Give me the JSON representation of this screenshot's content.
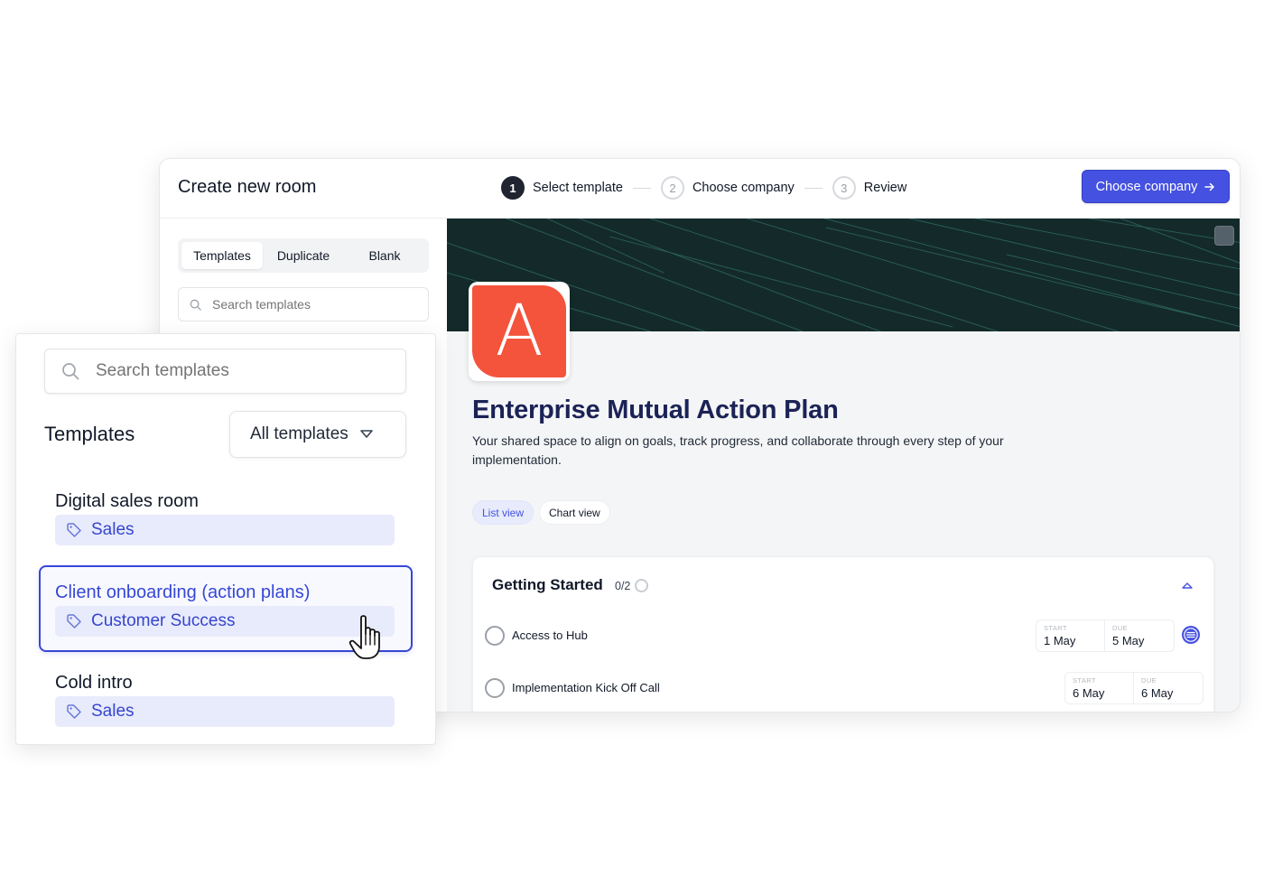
{
  "window": {
    "title": "Create new room",
    "steps": [
      {
        "num": "1",
        "label": "Select template"
      },
      {
        "num": "2",
        "label": "Choose company"
      },
      {
        "num": "3",
        "label": "Review"
      }
    ],
    "primary_button": "Choose company"
  },
  "left_pane": {
    "tabs": [
      "Templates",
      "Duplicate",
      "Blank"
    ],
    "search_placeholder": "Search templates"
  },
  "preview": {
    "logo_letter": "A",
    "title": "Enterprise Mutual Action Plan",
    "description": "Your shared space to align on goals, track progress, and collaborate through every step of your implementation.",
    "views": [
      "List view",
      "Chart view"
    ],
    "section": {
      "title": "Getting Started",
      "count": "0/2",
      "tasks": [
        {
          "name": "Access to Hub",
          "start_label": "START",
          "start": "1 May",
          "due_label": "DUE",
          "due": "5 May"
        },
        {
          "name": "Implementation Kick Off Call",
          "start_label": "START",
          "start": "6 May",
          "due_label": "DUE",
          "due": "6 May"
        }
      ]
    }
  },
  "panel": {
    "search_placeholder": "Search templates",
    "heading": "Templates",
    "filter_label": "All templates",
    "templates": [
      {
        "name": "Digital sales room",
        "tag": "Sales"
      },
      {
        "name": "Client onboarding (action plans)",
        "tag": "Customer Success"
      },
      {
        "name": "Cold intro",
        "tag": "Sales"
      }
    ]
  },
  "colors": {
    "accent": "#4551e0",
    "title_navy": "#1b2356",
    "logo": "#f4533c",
    "cover": "#142a2a",
    "tag_bg": "#e8ebfb"
  }
}
